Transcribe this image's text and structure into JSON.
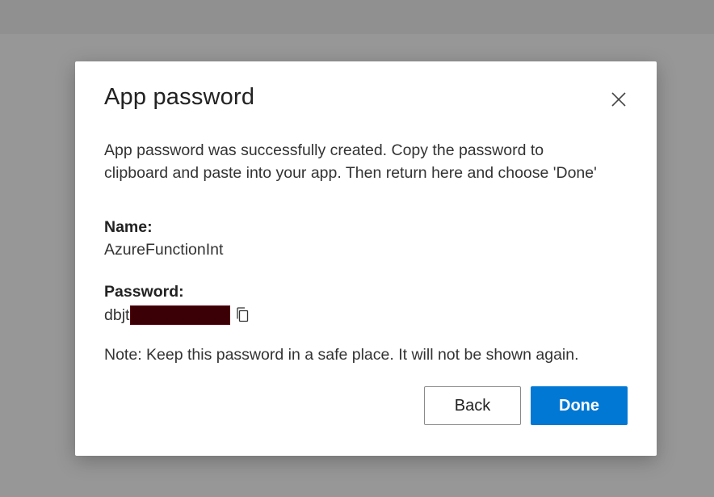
{
  "dialog": {
    "title": "App password",
    "message": "App password was successfully created. Copy the password to clipboard and paste into your app. Then return here and choose 'Done'",
    "name_label": "Name:",
    "name_value": "AzureFunctionInt",
    "password_label": "Password:",
    "password_visible_prefix": "dbjt",
    "note": "Note: Keep this password in a safe place. It will not be shown again.",
    "back_label": "Back",
    "done_label": "Done"
  },
  "icons": {
    "close": "close-icon",
    "copy": "copy-icon"
  },
  "colors": {
    "primary": "#0078d4",
    "overlay": "#979797",
    "redaction": "#3a0006"
  }
}
